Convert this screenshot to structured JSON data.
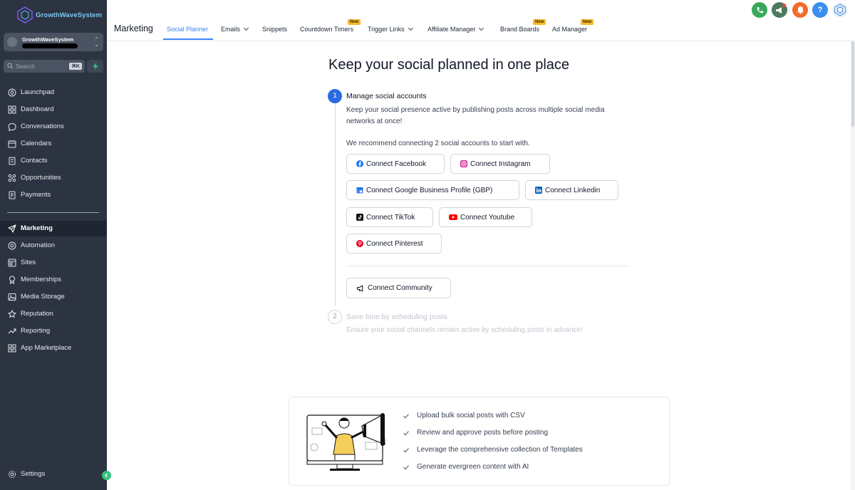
{
  "app": {
    "brand": "GrowthWaveSystem",
    "account_name": "GrowthWaveSystem",
    "search_placeholder": "Search",
    "search_shortcut": "⌘K"
  },
  "sidebar": {
    "items": [
      {
        "label": "Launchpad",
        "icon": "rocket-icon",
        "active": false
      },
      {
        "label": "Dashboard",
        "icon": "grid-icon",
        "active": false
      },
      {
        "label": "Conversations",
        "icon": "chat-icon",
        "active": false
      },
      {
        "label": "Calendars",
        "icon": "calendar-icon",
        "active": false
      },
      {
        "label": "Contacts",
        "icon": "contacts-icon",
        "active": false
      },
      {
        "label": "Opportunities",
        "icon": "opportunities-icon",
        "active": false
      },
      {
        "label": "Payments",
        "icon": "payments-icon",
        "active": false
      },
      {
        "label": "Marketing",
        "icon": "send-icon",
        "active": true
      },
      {
        "label": "Automation",
        "icon": "automation-icon",
        "active": false
      },
      {
        "label": "Sites",
        "icon": "sites-icon",
        "active": false
      },
      {
        "label": "Memberships",
        "icon": "membership-icon",
        "active": false
      },
      {
        "label": "Media Storage",
        "icon": "image-icon",
        "active": false
      },
      {
        "label": "Reputation",
        "icon": "star-icon",
        "active": false
      },
      {
        "label": "Reporting",
        "icon": "trend-icon",
        "active": false
      },
      {
        "label": "App Marketplace",
        "icon": "apps-icon",
        "active": false
      }
    ],
    "settings_label": "Settings"
  },
  "topnav": {
    "section_title": "Marketing",
    "tabs": [
      {
        "label": "Social Planner",
        "active": true,
        "dropdown": false,
        "new": false
      },
      {
        "label": "Emails",
        "active": false,
        "dropdown": true,
        "new": false
      },
      {
        "label": "Snippets",
        "active": false,
        "dropdown": false,
        "new": false
      },
      {
        "label": "Countdown Timers",
        "active": false,
        "dropdown": false,
        "new": true
      },
      {
        "label": "Trigger Links",
        "active": false,
        "dropdown": true,
        "new": false
      },
      {
        "label": "Affiliate Manager",
        "active": false,
        "dropdown": true,
        "new": false
      },
      {
        "label": "Brand Boards",
        "active": false,
        "dropdown": false,
        "new": true
      },
      {
        "label": "Ad Manager",
        "active": false,
        "dropdown": false,
        "new": true
      }
    ],
    "new_badge": "New",
    "header_icons": [
      {
        "name": "phone-icon",
        "color": "#3aa85b"
      },
      {
        "name": "megaphone-icon",
        "color": "#4b7a5c"
      },
      {
        "name": "bell-icon",
        "color": "#f26b2c"
      },
      {
        "name": "help-icon",
        "color": "#3b8ff0"
      }
    ]
  },
  "main": {
    "title": "Keep your social planned in one place",
    "step1": {
      "number": "1",
      "title": "Manage social accounts",
      "description": "Keep your social presence active by publishing posts across multiple social media networks at once!",
      "recommendation": "We recommend connecting 2 social accounts to start with."
    },
    "connect_buttons": [
      {
        "label": "Connect Facebook",
        "icon": "facebook-icon"
      },
      {
        "label": "Connect Instagram",
        "icon": "instagram-icon"
      },
      {
        "label": "Connect Google Business Profile (GBP)",
        "icon": "google-business-icon"
      },
      {
        "label": "Connect Linkedin",
        "icon": "linkedin-icon"
      },
      {
        "label": "Connect TikTok",
        "icon": "tiktok-icon"
      },
      {
        "label": "Connect Youtube",
        "icon": "youtube-icon"
      },
      {
        "label": "Connect Pinterest",
        "icon": "pinterest-icon"
      }
    ],
    "community_button": {
      "label": "Connect Community",
      "icon": "megaphone-icon"
    },
    "step2": {
      "number": "2",
      "title": "Save time by scheduling posts",
      "description": "Ensure your social channels remain active by scheduling posts in advance!"
    }
  },
  "features": [
    "Upload bulk social posts with CSV",
    "Review and approve posts before posting",
    "Leverage the comprehensive collection of Templates",
    "Generate evergreen content with AI"
  ],
  "colors": {
    "sidebar_bg": "#2c3442",
    "accent": "#3b82f6",
    "step_active": "#2b6ae0"
  }
}
